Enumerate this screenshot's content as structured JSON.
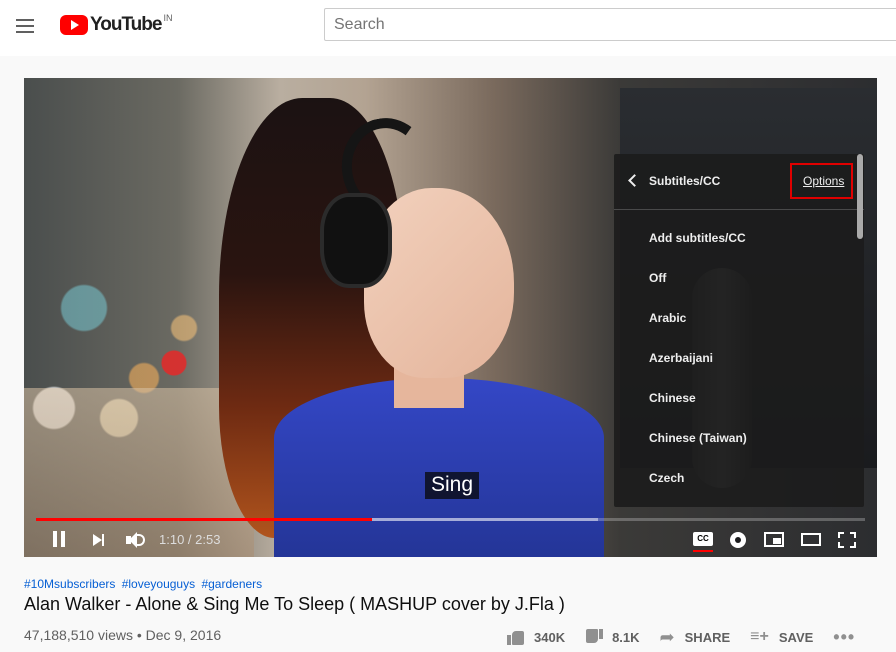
{
  "header": {
    "logo_text": "YouTube",
    "region": "IN",
    "search_placeholder": "Search"
  },
  "player": {
    "caption": "Sing",
    "time": "1:10 / 2:53",
    "progress_fraction": 0.405,
    "loaded_fraction": 0.678,
    "settings_panel": {
      "title": "Subtitles/CC",
      "options_label": "Options",
      "items": [
        {
          "label": "Add subtitles/CC"
        },
        {
          "label": "Off"
        },
        {
          "label": "Arabic"
        },
        {
          "label": "Azerbaijani"
        },
        {
          "label": "Chinese"
        },
        {
          "label": "Chinese (Taiwan)"
        },
        {
          "label": "Czech"
        }
      ]
    },
    "cc_label": "CC"
  },
  "video": {
    "hashtags": [
      "#10Msubscribers",
      "#loveyouguys",
      "#gardeners"
    ],
    "title": "Alan Walker - Alone & Sing Me To Sleep ( MASHUP cover by J.Fla )",
    "views": "47,188,510 views • Dec 9, 2016",
    "likes": "340K",
    "dislikes": "8.1K",
    "share_label": "SHARE",
    "save_label": "SAVE"
  },
  "colors": {
    "accent": "#ff0000",
    "link": "#065fd4",
    "highlight_box": "#e00000"
  }
}
